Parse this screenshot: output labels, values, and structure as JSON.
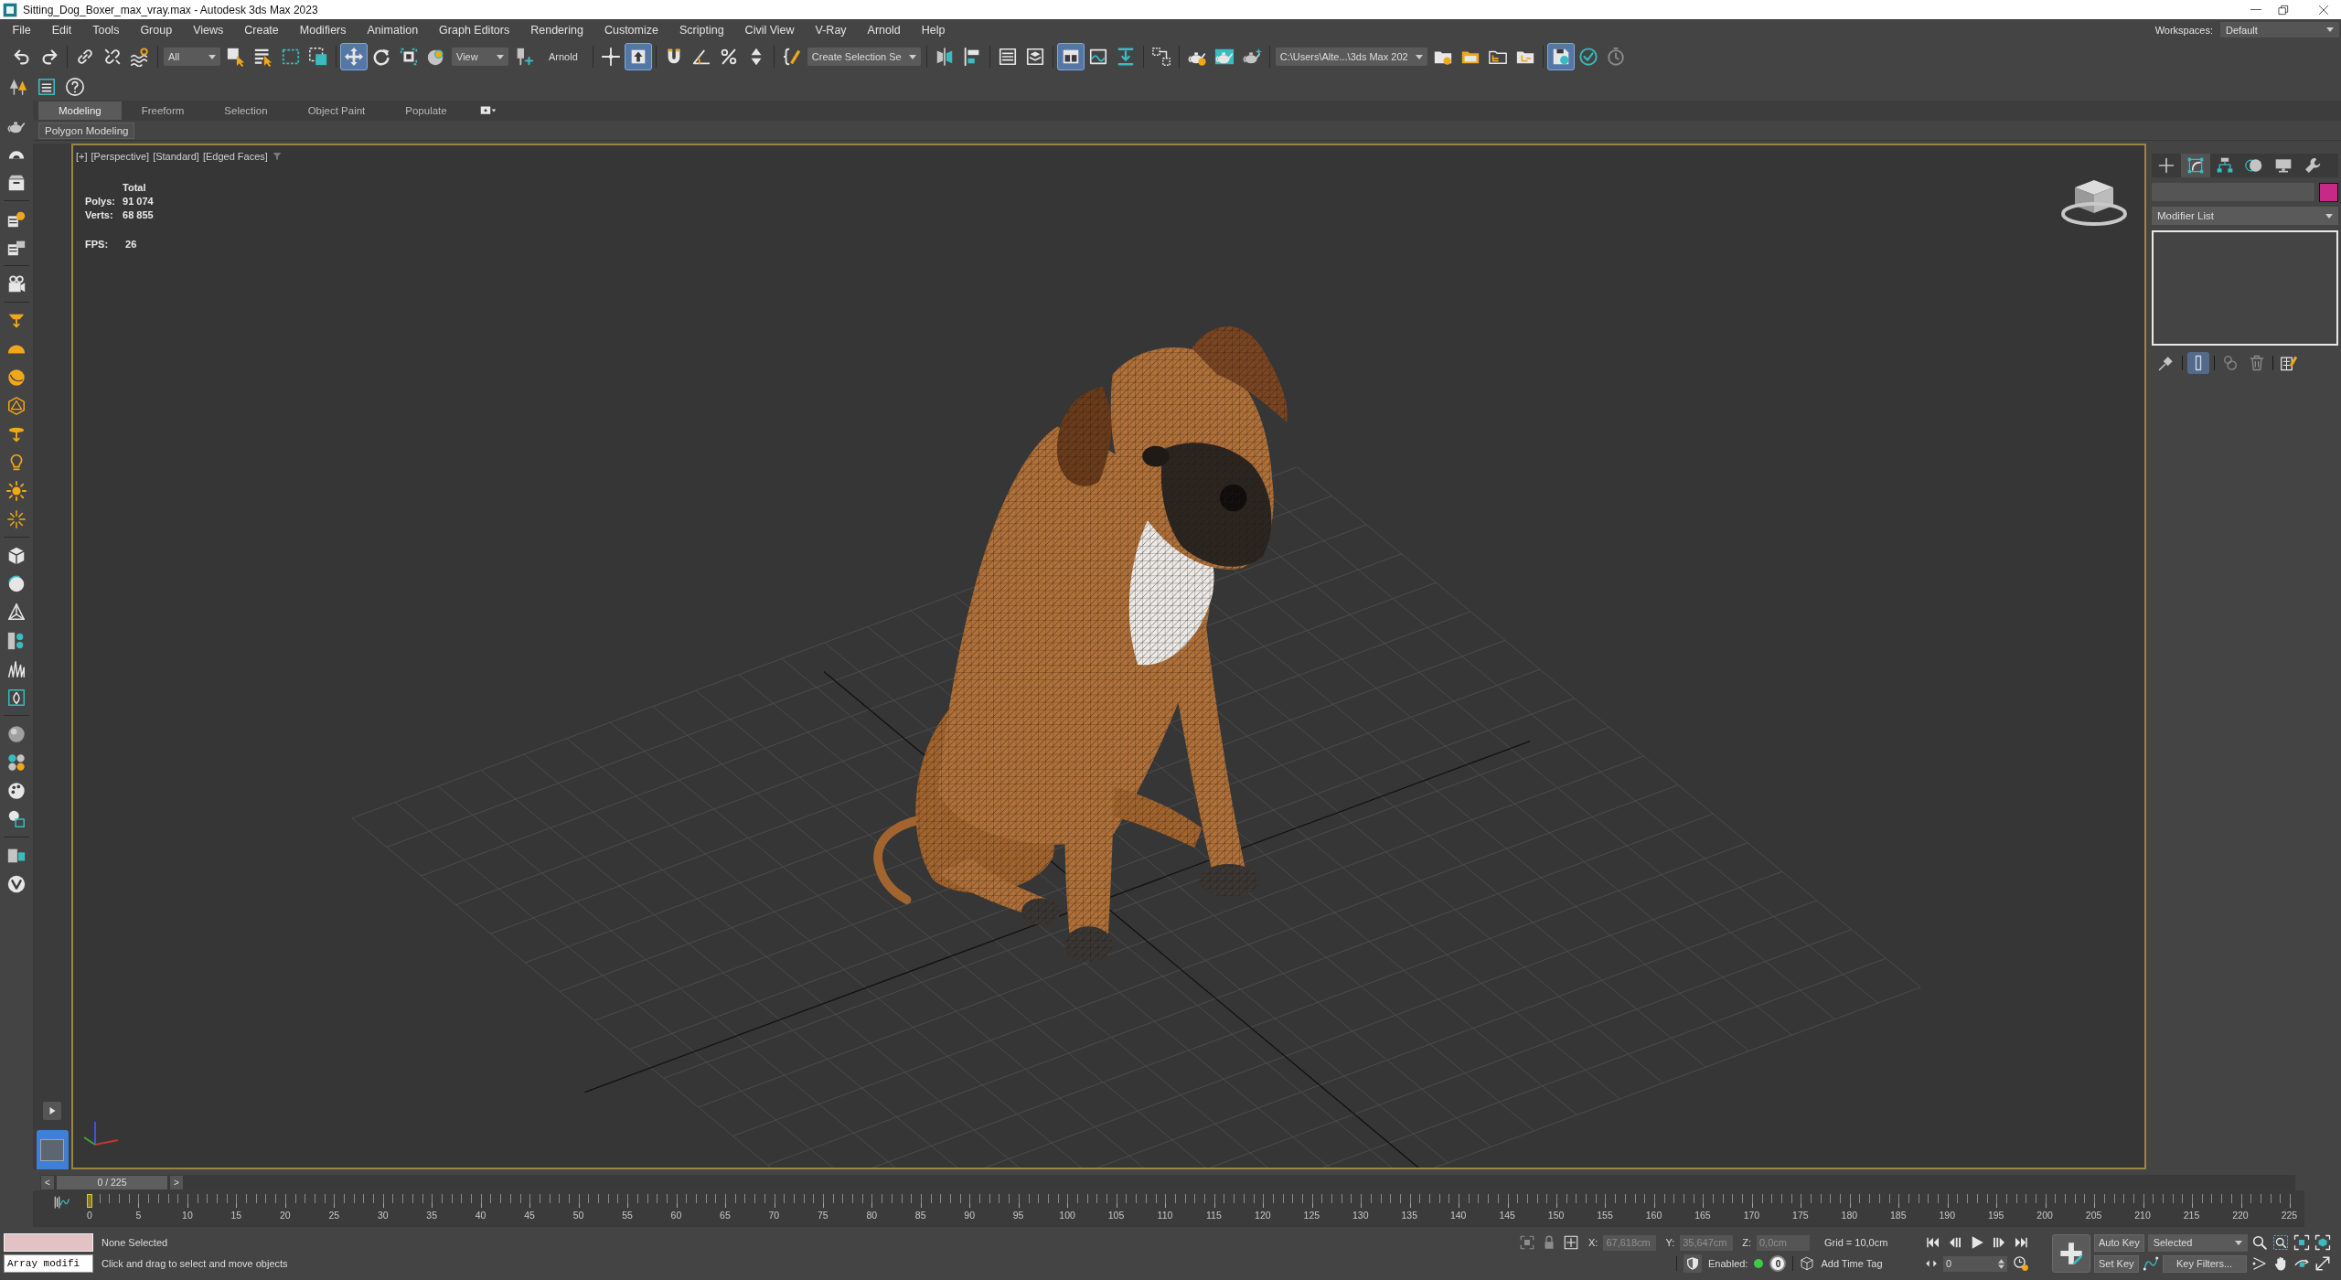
{
  "window": {
    "title": "Sitting_Dog_Boxer_max_vray.max - Autodesk 3ds Max 2023"
  },
  "menu_bar": {
    "items": [
      "File",
      "Edit",
      "Tools",
      "Group",
      "Views",
      "Create",
      "Modifiers",
      "Animation",
      "Graph Editors",
      "Rendering",
      "Customize",
      "Scripting",
      "Civil View",
      "V-Ray",
      "Arnold",
      "Help"
    ],
    "workspaces_label": "Workspaces:",
    "workspace": "Default"
  },
  "main_toolbar": {
    "groups": [
      [
        {
          "kind": "tool",
          "on": false
        },
        {
          "kind": "tool",
          "on": false
        }
      ],
      [
        {
          "kind": "tool",
          "on": false
        },
        {
          "kind": "tool",
          "on": false
        },
        {
          "kind": "tool",
          "on": false
        }
      ],
      [
        {
          "kind": "dropdown",
          "value": "All"
        },
        {
          "kind": "tool",
          "on": false
        },
        {
          "kind": "tool",
          "on": false
        },
        {
          "kind": "tool",
          "on": false
        },
        {
          "kind": "tool",
          "on": false
        }
      ],
      [
        {
          "kind": "tool",
          "on": true
        },
        {
          "kind": "tool",
          "on": false
        },
        {
          "kind": "tool",
          "on": false
        },
        {
          "kind": "tool",
          "on": false
        },
        {
          "kind": "dropdown",
          "value": "View"
        },
        {
          "kind": "tool",
          "on": false
        },
        {
          "kind": "label",
          "text": "Arnold"
        }
      ],
      [
        {
          "kind": "tool",
          "on": false
        },
        {
          "kind": "tool",
          "on": true
        }
      ],
      [
        {
          "kind": "tool",
          "on": false
        },
        {
          "kind": "tool",
          "on": false
        },
        {
          "kind": "tool",
          "on": false
        },
        {
          "kind": "tool",
          "on": false
        }
      ],
      [
        {
          "kind": "tool",
          "on": false
        },
        {
          "kind": "dropdown",
          "value": "Create Selection Se"
        }
      ],
      [
        {
          "kind": "tool",
          "on": false
        },
        {
          "kind": "tool",
          "on": false
        }
      ],
      [
        {
          "kind": "tool",
          "on": false
        },
        {
          "kind": "tool",
          "on": false
        }
      ],
      [
        {
          "kind": "tool",
          "on": true
        },
        {
          "kind": "tool",
          "on": false
        },
        {
          "kind": "tool",
          "on": false
        }
      ],
      [
        {
          "kind": "tool",
          "on": false
        }
      ],
      [
        {
          "kind": "tool",
          "on": false
        },
        {
          "kind": "tool",
          "on": false
        },
        {
          "kind": "tool",
          "on": false
        }
      ],
      [
        {
          "kind": "dropdown",
          "value": "C:\\Users\\Alte...\\3ds Max 202"
        },
        {
          "kind": "tool",
          "on": false
        },
        {
          "kind": "tool",
          "on": false
        },
        {
          "kind": "tool",
          "on": false
        },
        {
          "kind": "tool",
          "on": false
        }
      ],
      [
        {
          "kind": "tool",
          "on": true
        },
        {
          "kind": "tool",
          "on": false
        },
        {
          "kind": "tool",
          "on": false
        }
      ]
    ]
  },
  "ribbon": {
    "tabs": [
      {
        "label": "Modeling",
        "selected": true
      },
      {
        "label": "Freeform",
        "selected": false
      },
      {
        "label": "Selection",
        "selected": false
      },
      {
        "label": "Object Paint",
        "selected": false
      },
      {
        "label": "Populate",
        "selected": false
      }
    ],
    "panel_button": "Polygon Modeling"
  },
  "viewport": {
    "menus": [
      "[+]",
      "[Perspective]",
      "[Standard]",
      "[Edged Faces]"
    ],
    "stats": {
      "header": "Total",
      "rows": [
        {
          "label": "Polys:",
          "value": "91 074"
        },
        {
          "label": "Verts:",
          "value": "68 855"
        }
      ],
      "fps_label": "FPS:",
      "fps": "26"
    }
  },
  "command_panel": {
    "tabs": [
      {
        "selected": false
      },
      {
        "selected": true
      },
      {
        "selected": false
      },
      {
        "selected": false
      },
      {
        "selected": false
      },
      {
        "selected": false
      }
    ],
    "modifier_list": "Modifier List",
    "stack_tools": [
      {
        "on": false
      },
      {
        "on": true
      },
      {
        "on": false
      },
      {
        "on": false
      },
      {
        "on": false
      }
    ]
  },
  "time_slider": {
    "previous": "<",
    "position": "0 / 225",
    "next": ">",
    "level": 0
  },
  "track_bar": {
    "frame_labels": [
      "0",
      "5",
      "10",
      "15",
      "20",
      "25",
      "30",
      "35",
      "40",
      "45",
      "50",
      "55",
      "60",
      "65",
      "70",
      "75",
      "80",
      "85",
      "90",
      "95",
      "100",
      "105",
      "110",
      "115",
      "120",
      "125",
      "130",
      "135",
      "140",
      "145",
      "150",
      "155",
      "160",
      "165",
      "170",
      "175",
      "180",
      "185",
      "190",
      "195",
      "200",
      "205",
      "210",
      "215",
      "220",
      "225"
    ]
  },
  "status_bar": {
    "listener_input": "Array modifi",
    "selection": "None Selected",
    "prompt": "Click and drag to select and move objects",
    "coordinates": [
      {
        "axis": "X:",
        "value": "67,618cm",
        "disabled": true
      },
      {
        "axis": "Y:",
        "value": "35,647cm",
        "disabled": true
      },
      {
        "axis": "Z:",
        "value": "0,0cm",
        "disabled": true
      }
    ],
    "grid": "Grid = 10,0cm",
    "enabled_label": "Enabled:",
    "enabled": true,
    "tag_counter": "0",
    "add_time_tag": "Add Time Tag",
    "auto_key": "Auto Key",
    "key_set": "Selected",
    "set_key": "Set Key",
    "key_filters": "Key Filters...",
    "frame": "0"
  }
}
